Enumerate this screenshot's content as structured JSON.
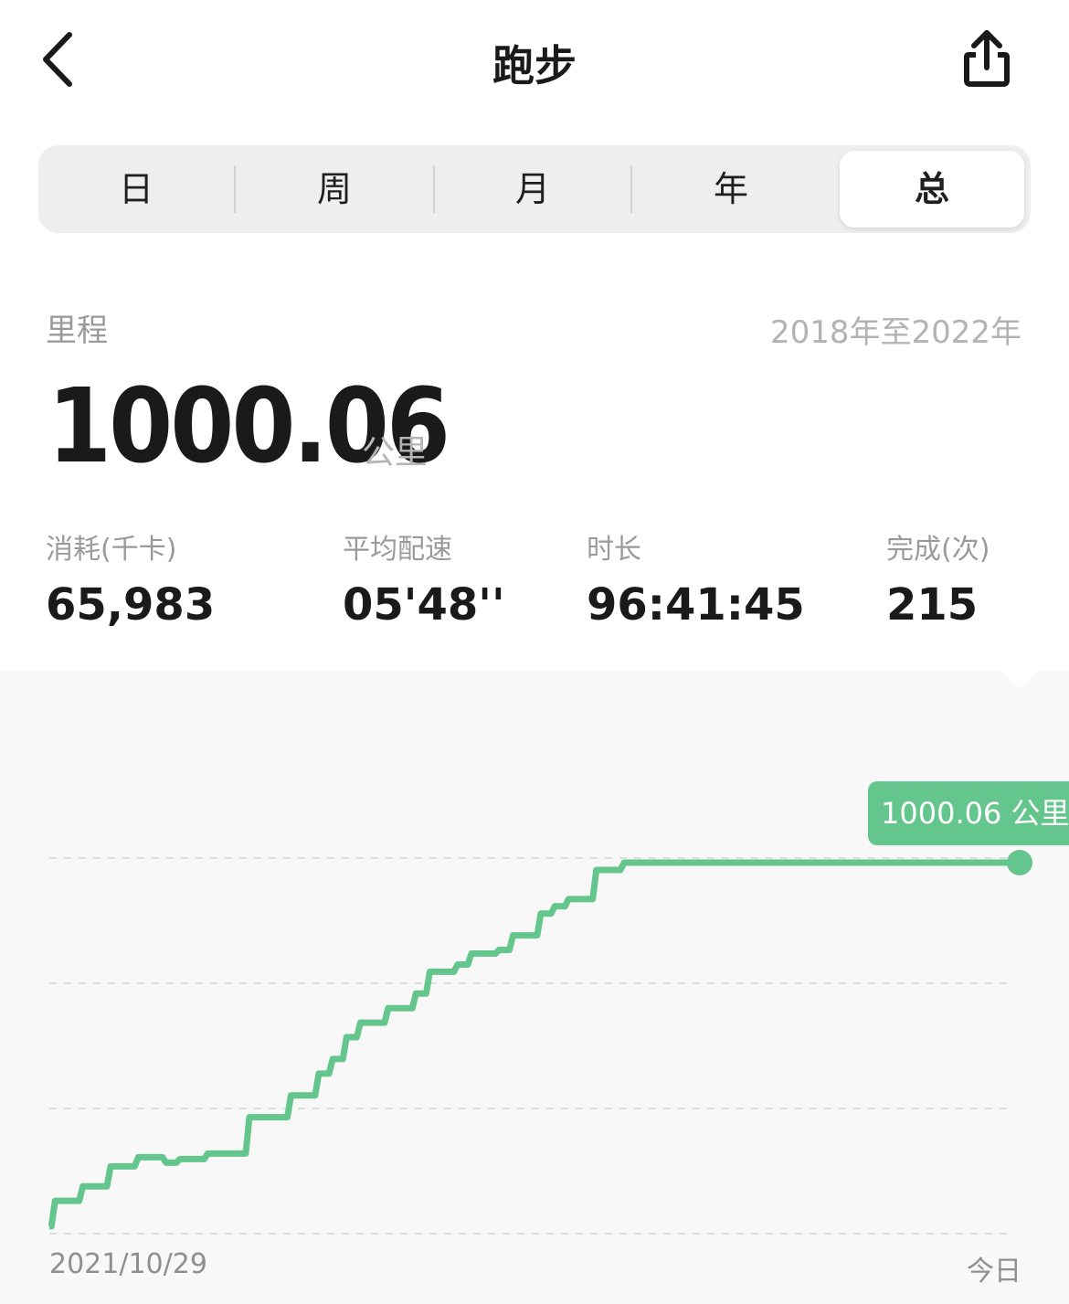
{
  "header": {
    "title": "跑步",
    "back_icon": "chevron-left-icon",
    "share_icon": "share-icon"
  },
  "tabs": [
    {
      "label": "日",
      "active": false
    },
    {
      "label": "周",
      "active": false
    },
    {
      "label": "月",
      "active": false
    },
    {
      "label": "年",
      "active": false
    },
    {
      "label": "总",
      "active": true
    }
  ],
  "summary": {
    "label": "里程",
    "date_range": "2018年至2022年",
    "value": "1000.06",
    "unit": "公里"
  },
  "stats": [
    {
      "label": "消耗(千卡)",
      "value": "65,983"
    },
    {
      "label": "平均配速",
      "value": "05'48''"
    },
    {
      "label": "时长",
      "value": "96:41:45"
    },
    {
      "label": "完成(次)",
      "value": "215"
    }
  ],
  "chart_data": {
    "type": "line",
    "step": true,
    "x_start_label": "2021/10/29",
    "x_end_label": "今日",
    "y_unit": "公里",
    "tooltip": "1000.06 公里",
    "grid": "horizontal-dashed",
    "line_color": "#64c68c",
    "y_min": 0,
    "y_max": 1000.06,
    "series": [
      {
        "values": [
          0,
          70,
          70,
          110,
          110,
          165,
          165,
          190,
          190,
          175,
          185,
          185,
          200,
          200,
          200,
          300,
          300,
          300,
          360,
          360,
          420,
          460,
          520,
          560,
          560,
          600,
          600,
          640,
          700,
          700,
          720,
          750,
          750,
          760,
          800,
          800,
          860,
          880,
          900,
          900,
          980,
          980,
          1000.06,
          1000.06
        ]
      }
    ]
  },
  "colors": {
    "accent": "#64c68c",
    "chart_bg": "#f8f8f8",
    "segment_bg": "#eeeeee"
  }
}
